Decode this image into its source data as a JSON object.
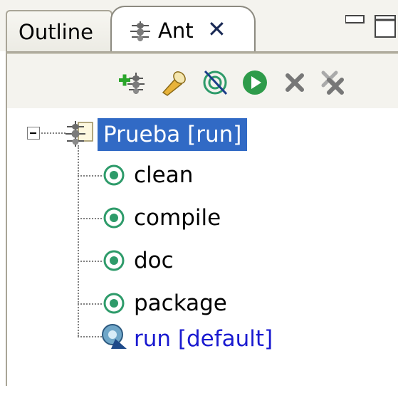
{
  "tabs": [
    {
      "label": "Outline",
      "active": false
    },
    {
      "label": "Ant",
      "active": true,
      "icon": "ant-icon",
      "closable": true
    }
  ],
  "window_buttons": [
    "minimize-icon",
    "maximize-icon"
  ],
  "toolbar": {
    "buttons": [
      "add-buildfile-icon",
      "search-icon",
      "hide-internal-targets-icon",
      "run-icon",
      "remove-icon",
      "remove-all-icon"
    ]
  },
  "tree": {
    "root": {
      "label": "Prueba [run]",
      "selected": true,
      "expanded": true,
      "icon": "buildfile-icon"
    },
    "targets": [
      {
        "label": "clean",
        "icon": "target-icon",
        "default": false
      },
      {
        "label": "compile",
        "icon": "target-icon",
        "default": false
      },
      {
        "label": "doc",
        "icon": "target-icon",
        "default": false
      },
      {
        "label": "package",
        "icon": "target-icon",
        "default": false
      },
      {
        "label": "run [default]",
        "icon": "default-target-icon",
        "default": true
      }
    ]
  },
  "colors": {
    "selection": "#316ac5",
    "default_target_text": "#1a1ad0",
    "target_icon_green": "#2e9b6a"
  }
}
